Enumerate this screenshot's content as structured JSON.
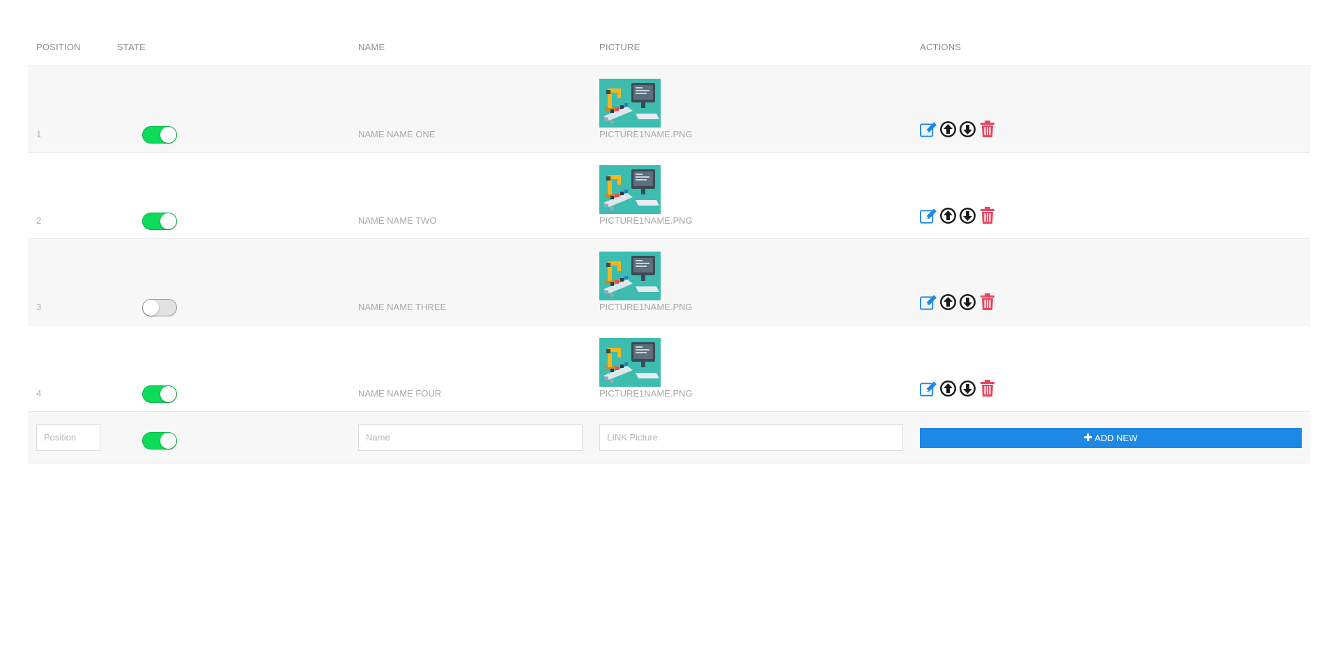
{
  "table": {
    "headers": {
      "position": "POSITION",
      "state": "STATE",
      "name": "NAME",
      "picture": "PICTURE",
      "actions": "ACTIONS"
    },
    "rows": [
      {
        "position": "1",
        "state": "on",
        "name": "NAME NAME ONE",
        "picture_caption": "PICTURE1NAME.PNG",
        "picture_icon": "factory-robot-arm-computer-illustration"
      },
      {
        "position": "2",
        "state": "on",
        "name": "NAME NAME TWO",
        "picture_caption": "PICTURE1NAME.PNG",
        "picture_icon": "factory-robot-arm-computer-illustration"
      },
      {
        "position": "3",
        "state": "off",
        "name": "NAME NAME THREE",
        "picture_caption": "PICTURE1NAME.PNG",
        "picture_icon": "factory-robot-arm-computer-illustration"
      },
      {
        "position": "4",
        "state": "on",
        "name": "NAME NAME FOUR",
        "picture_caption": "PICTURE1NAME.PNG",
        "picture_icon": "factory-robot-arm-computer-illustration"
      }
    ],
    "row_action_icons": [
      "edit-icon",
      "arrow-up-circle-icon",
      "arrow-down-circle-icon",
      "trash-icon"
    ]
  },
  "new_entry": {
    "position_placeholder": "Position",
    "name_placeholder": "Name",
    "picture_placeholder": "LINK Picture",
    "state": "on",
    "add_button_label": "ADD NEW",
    "add_button_icon": "plus-icon"
  },
  "colors": {
    "toggle_on": "#0ddb5a",
    "toggle_off": "#e2e2e2",
    "accent_blue": "#1e88e5",
    "delete_red": "#e8455e",
    "row_shade": "#f7f7f7",
    "thumb_bg": "#3dbcb0"
  }
}
